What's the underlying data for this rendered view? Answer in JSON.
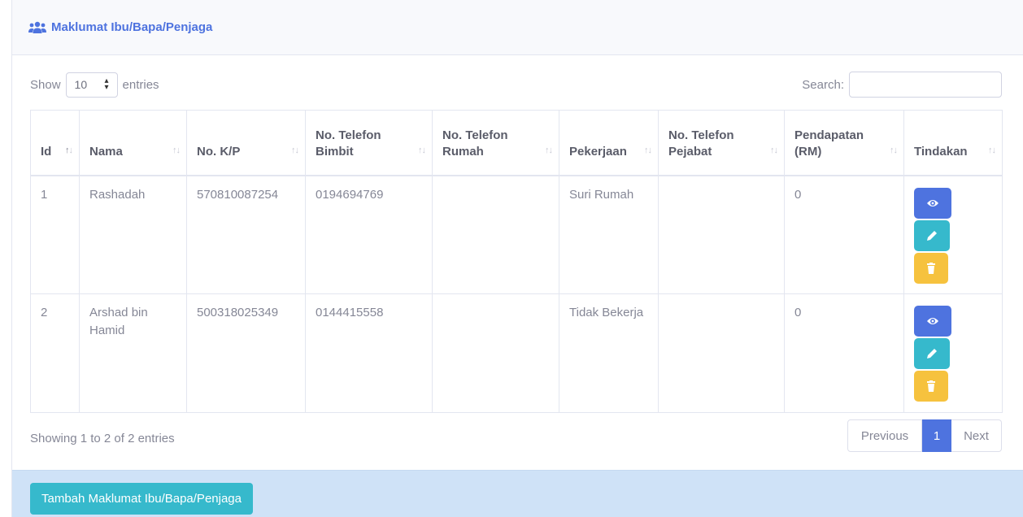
{
  "card": {
    "title": "Maklumat Ibu/Bapa/Penjaga",
    "title_icon": "users-icon"
  },
  "controls": {
    "show_label": "Show",
    "entries_value": "10",
    "entries_label": "entries",
    "search_label": "Search:",
    "search_value": ""
  },
  "table": {
    "columns": [
      "Id",
      "Nama",
      "No. K/P",
      "No. Telefon Bimbit",
      "No. Telefon Rumah",
      "Pekerjaan",
      "No. Telefon Pejabat",
      "Pendapatan (RM)",
      "Tindakan"
    ],
    "rows": [
      {
        "id": "1",
        "nama": "Rashadah",
        "kp": "570810087254",
        "bimbit": "0194694769",
        "rumah": "",
        "pekerjaan": "Suri Rumah",
        "pejabat": "",
        "pendapatan": "0"
      },
      {
        "id": "2",
        "nama": "Arshad bin Hamid",
        "kp": "500318025349",
        "bimbit": "0144415558",
        "rumah": "",
        "pekerjaan": "Tidak Bekerja",
        "pejabat": "",
        "pendapatan": "0"
      }
    ],
    "action_icons": [
      "eye-icon",
      "pencil-icon",
      "trash-icon"
    ]
  },
  "footer": {
    "info": "Showing 1 to 2 of 2 entries",
    "previous": "Previous",
    "current_page": "1",
    "next": "Next",
    "add_button": "Tambah Maklumat Ibu/Bapa/Penjaga"
  },
  "colors": {
    "primary": "#4e73df",
    "info": "#36b9cc",
    "warning": "#f6c23e",
    "footer_bg": "#cfe2f7"
  }
}
